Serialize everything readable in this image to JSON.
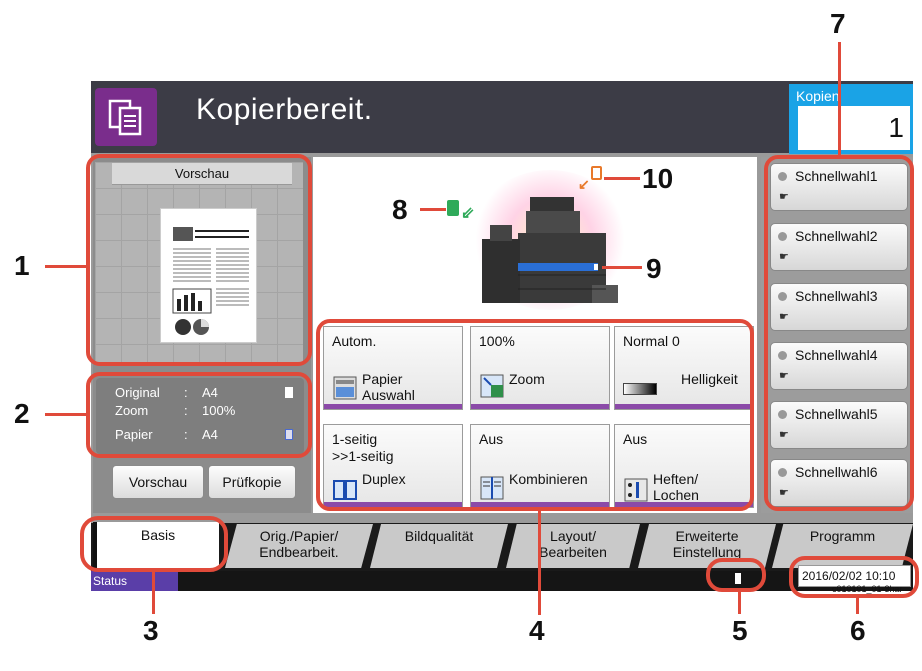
{
  "header": {
    "title": "Kopierbereit.",
    "copies_label": "Kopien",
    "copies_value": "1"
  },
  "preview": {
    "tab_label": "Vorschau",
    "doc_heading": "Tips Using fonts hard effs and more"
  },
  "info": {
    "rows": [
      {
        "key": "Original",
        "sep": ":",
        "value": "A4"
      },
      {
        "key": "Zoom",
        "sep": ":",
        "value": "100%"
      },
      {
        "key": "Papier",
        "sep": ":",
        "value": "A4"
      }
    ]
  },
  "left_buttons": {
    "preview": "Vorschau",
    "check_copy": "Prüfkopie"
  },
  "functions": [
    {
      "value": "Autom.",
      "label": "Papier\nAuswahl"
    },
    {
      "value": "100%",
      "label": "Zoom"
    },
    {
      "value": "Normal 0",
      "label": "Helligkeit"
    },
    {
      "value": "1-seitig\n>>1-seitig",
      "label": "Duplex"
    },
    {
      "value": "Aus",
      "label": "Kombinieren"
    },
    {
      "value": "Aus",
      "label": "Heften/\nLochen"
    }
  ],
  "shortcuts": [
    "Schnellwahl1",
    "Schnellwahl2",
    "Schnellwahl3",
    "Schnellwahl4",
    "Schnellwahl5",
    "Schnellwahl6"
  ],
  "tabs": [
    {
      "label": "Basis"
    },
    {
      "label": "Orig./Papier/\nEndbearbeit."
    },
    {
      "label": "Bildqualität"
    },
    {
      "label": "Layout/\nBearbeiten"
    },
    {
      "label": "Erweiterte\nEinstellung"
    },
    {
      "label": "Programm"
    }
  ],
  "status": {
    "label": "Status",
    "datetime": "2016/02/02  10:10",
    "device_id": "c010101_01-3har"
  },
  "callouts": [
    "1",
    "2",
    "3",
    "4",
    "5",
    "6",
    "7",
    "8",
    "9",
    "10"
  ],
  "colors": {
    "accent_purple": "#8b4aa8",
    "copies_blue": "#1aa3e6",
    "callout_red": "#e04a3a",
    "header_dark": "#3c3c46"
  }
}
